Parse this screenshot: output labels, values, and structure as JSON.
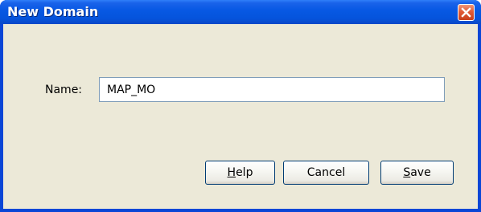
{
  "window": {
    "title": "New Domain"
  },
  "form": {
    "name_label": "Name:",
    "name_value": "MAP_MO"
  },
  "buttons": {
    "help": {
      "mnemonic": "H",
      "rest": "elp"
    },
    "cancel": {
      "label": "Cancel"
    },
    "save": {
      "mnemonic": "S",
      "rest": "ave"
    }
  },
  "icons": {
    "close": "close-icon"
  },
  "colors": {
    "titlebar": "#0554dc",
    "close_button": "#e05a36",
    "client_background": "#ece9d8",
    "input_border": "#7f9db9",
    "button_border": "#003c74"
  }
}
